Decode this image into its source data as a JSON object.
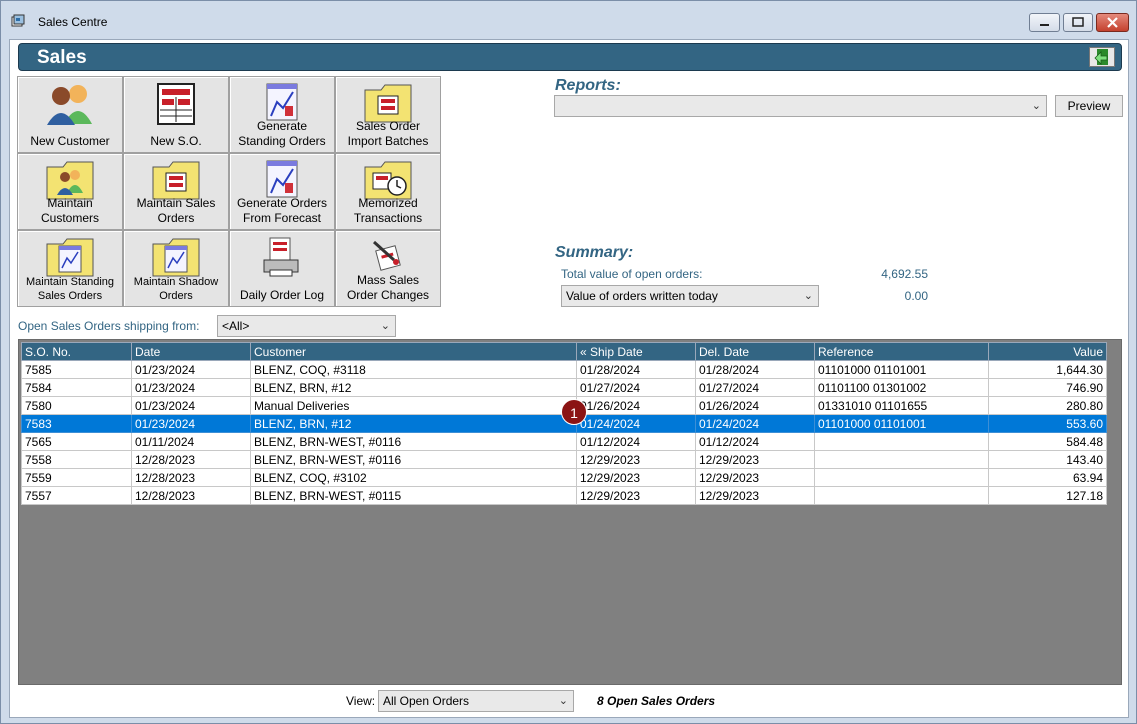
{
  "window": {
    "title": "Sales Centre"
  },
  "header": {
    "title": "Sales"
  },
  "tiles": [
    {
      "label": "New Customer",
      "icon": "people-icon"
    },
    {
      "label": "New S.O.",
      "icon": "order-form-icon"
    },
    {
      "label": "Generate\nStanding Orders",
      "icon": "document-chart-icon"
    },
    {
      "label": "Sales Order\nImport Batches",
      "icon": "folder-form-icon"
    },
    {
      "label": "Maintain\nCustomers",
      "icon": "folder-people-icon"
    },
    {
      "label": "Maintain Sales\nOrders",
      "icon": "folder-form-icon"
    },
    {
      "label": "Generate Orders\nFrom Forecast",
      "icon": "document-chart-icon"
    },
    {
      "label": "Memorized\nTransactions",
      "icon": "folder-clock-icon"
    },
    {
      "label": "Maintain Standing\nSales Orders",
      "icon": "folder-document-icon"
    },
    {
      "label": "Maintain Shadow\nOrders",
      "icon": "folder-document-icon"
    },
    {
      "label": "Daily Order Log",
      "icon": "printer-log-icon"
    },
    {
      "label": "Mass Sales\nOrder Changes",
      "icon": "pen-document-icon"
    }
  ],
  "reports": {
    "heading": "Reports:",
    "selected": "",
    "preview_label": "Preview"
  },
  "summary": {
    "heading": "Summary:",
    "open_label": "Total value of open orders:",
    "open_value": "4,692.55",
    "today_select": "Value of orders written today",
    "today_value": "0.00"
  },
  "filter": {
    "label": "Open Sales Orders shipping from:",
    "selected": "<All>"
  },
  "table": {
    "columns": [
      "S.O. No.",
      "Date",
      "Customer",
      "« Ship Date",
      "Del. Date",
      "Reference",
      "Value"
    ],
    "rows": [
      [
        "7585",
        "01/23/2024",
        "BLENZ, COQ, #3118",
        "01/28/2024",
        "01/28/2024",
        "01101000 01101001",
        "1,644.30"
      ],
      [
        "7584",
        "01/23/2024",
        "BLENZ, BRN, #12",
        "01/27/2024",
        "01/27/2024",
        "01101100 01301002",
        "746.90"
      ],
      [
        "7580",
        "01/23/2024",
        "Manual Deliveries",
        "01/26/2024",
        "01/26/2024",
        "01331010 01101655",
        "280.80"
      ],
      [
        "7583",
        "01/23/2024",
        "BLENZ, BRN, #12",
        "01/24/2024",
        "01/24/2024",
        "01101000 01101001",
        "553.60"
      ],
      [
        "7565",
        "01/11/2024",
        "BLENZ, BRN-WEST, #0116",
        "01/12/2024",
        "01/12/2024",
        "",
        "584.48"
      ],
      [
        "7558",
        "12/28/2023",
        "BLENZ, BRN-WEST, #0116",
        "12/29/2023",
        "12/29/2023",
        "",
        "143.40"
      ],
      [
        "7559",
        "12/28/2023",
        "BLENZ, COQ, #3102",
        "12/29/2023",
        "12/29/2023",
        "",
        "63.94"
      ],
      [
        "7557",
        "12/28/2023",
        "BLENZ, BRN-WEST, #0115",
        "12/29/2023",
        "12/29/2023",
        "",
        "127.18"
      ]
    ],
    "selected_row": 3
  },
  "marker": {
    "label": "1"
  },
  "footer": {
    "view_label": "View:",
    "view_selected": "All Open Orders",
    "count_text": "8 Open Sales Orders"
  },
  "colors": {
    "accent": "#336583",
    "selection": "#0078d7",
    "marker": "#8b1414"
  }
}
